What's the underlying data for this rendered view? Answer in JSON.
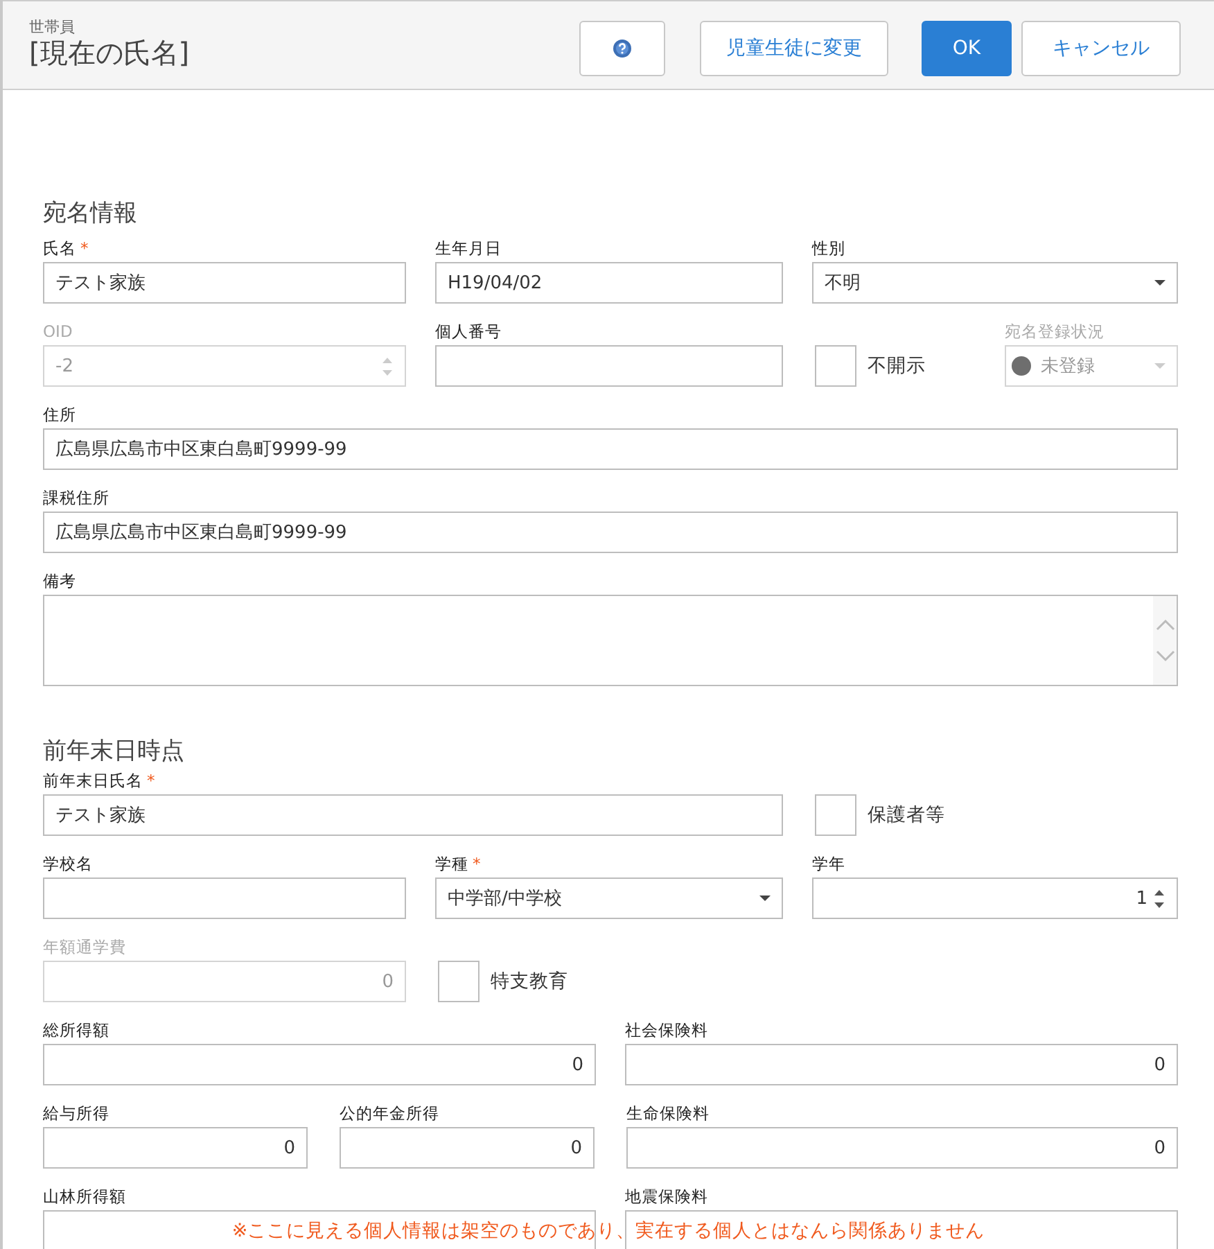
{
  "header": {
    "subtitle": "世帯員",
    "title": "[現在の氏名]",
    "buttons": [
      {
        "kind": "help"
      },
      {
        "kind": "default",
        "label": "児童生徒に変更"
      },
      {
        "kind": "primary",
        "label": "OK"
      },
      {
        "kind": "default",
        "label": "キャンセル"
      }
    ]
  },
  "sections": [
    {
      "title": "宛名情報",
      "rows": [
        [
          {
            "kind": "text",
            "label": "氏名",
            "mark": "*",
            "value": "テスト家族"
          },
          {
            "kind": "text",
            "label": "生年月日",
            "value": "H19/04/02"
          },
          {
            "kind": "select",
            "label": "性別",
            "value": "不明"
          }
        ],
        [
          {
            "kind": "spinner",
            "label": "OID",
            "disabled": true,
            "value": "-2"
          },
          {
            "kind": "text",
            "label": "個人番号"
          },
          {
            "kind": "checkbox",
            "label": "不開示",
            "checked": false
          },
          {
            "kind": "status",
            "label": "宛名登録状況",
            "disabled": true,
            "value": "未登録",
            "color": "#6e6e6e"
          }
        ],
        [
          {
            "kind": "text",
            "label": "住所",
            "value": "広島県広島市中区東白島町9999-99"
          }
        ],
        [
          {
            "kind": "text",
            "label": "課税住所",
            "value": "広島県広島市中区東白島町9999-99"
          }
        ],
        [
          {
            "kind": "textarea",
            "label": "備考"
          }
        ]
      ]
    },
    {
      "title": "前年末日時点",
      "rows": [
        [
          {
            "kind": "text",
            "label": "前年末日氏名",
            "mark": "*",
            "value": "テスト家族"
          },
          {
            "kind": "checkbox",
            "label": "保護者等",
            "checked": false
          }
        ],
        [
          {
            "kind": "text",
            "label": "学校名"
          },
          {
            "kind": "select",
            "label": "学種",
            "mark": "*",
            "value": "中学部/中学校"
          },
          {
            "kind": "spinner",
            "label": "学年",
            "numeric": true,
            "value": "1"
          }
        ],
        [
          {
            "kind": "text",
            "label": "年額通学費",
            "disabled": true,
            "numeric": true,
            "value": "0"
          },
          {
            "kind": "checkbox",
            "label": "特支教育",
            "checked": false
          }
        ],
        [
          {
            "kind": "text",
            "label": "総所得額",
            "numeric": true,
            "value": "0"
          },
          {
            "kind": "text",
            "label": "社会保険料",
            "numeric": true,
            "value": "0"
          }
        ],
        [
          {
            "kind": "text",
            "label": "給与所得",
            "numeric": true,
            "value": "0"
          },
          {
            "kind": "text",
            "label": "公的年金所得",
            "numeric": true,
            "value": "0"
          },
          {
            "kind": "text",
            "label": "生命保険料",
            "numeric": true,
            "value": "0"
          }
        ],
        [
          {
            "kind": "text",
            "label": "山林所得額"
          },
          {
            "kind": "text",
            "label": "地震保険料"
          }
        ]
      ]
    }
  ],
  "notice": "※ここに見える個人情報は架空のものであり、実在する個人とはなんら関係ありません"
}
